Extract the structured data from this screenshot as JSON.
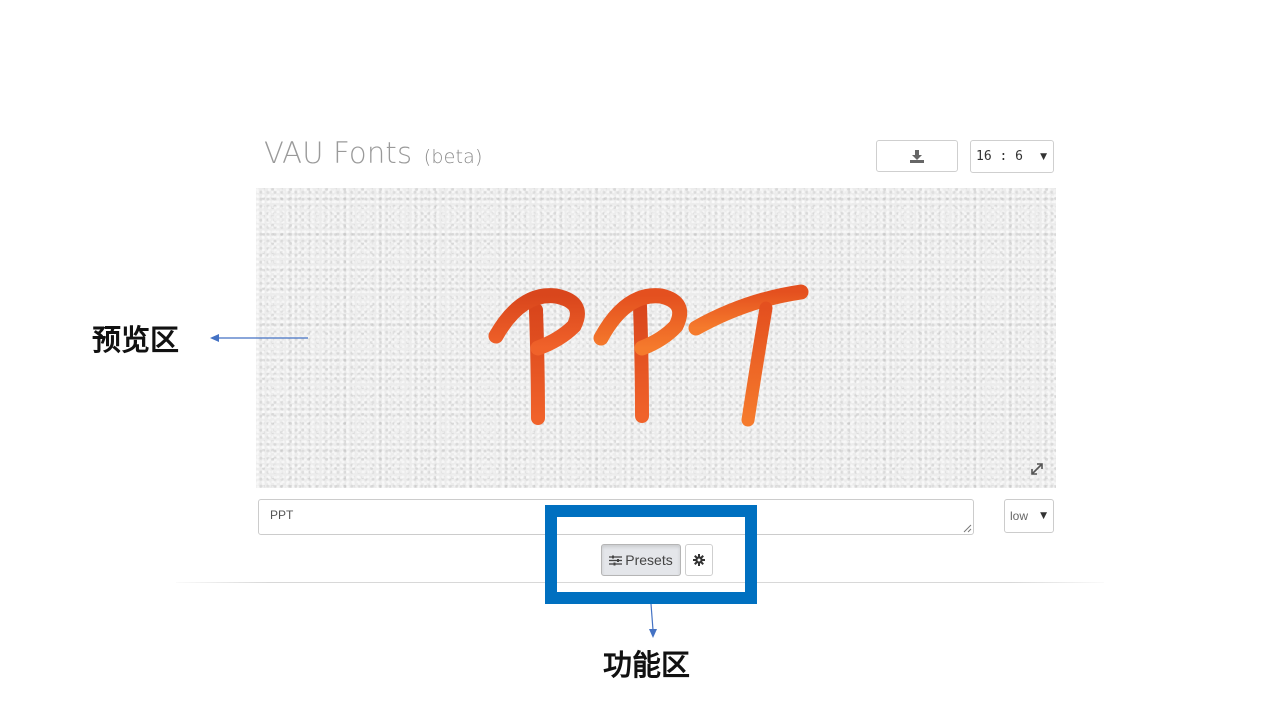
{
  "app": {
    "title": "VAU Fonts",
    "badge": "(beta)"
  },
  "toolbar": {
    "download_icon": "download-icon",
    "aspect_ratio": "16 : 6"
  },
  "preview": {
    "rendered_text": "PPT",
    "texture": "watercolor paper",
    "ink_color": "#e8511d",
    "expand_icon": "expand-icon"
  },
  "editor": {
    "text_value": "PPT",
    "quality": "low"
  },
  "actions": {
    "presets_label": "Presets",
    "presets_icon": "sliders-icon",
    "settings_icon": "gear-icon"
  },
  "annotations": {
    "preview_area_label": "预览区",
    "function_area_label": "功能区",
    "highlight_color": "#0070c0",
    "arrow_color": "#4472c4"
  }
}
